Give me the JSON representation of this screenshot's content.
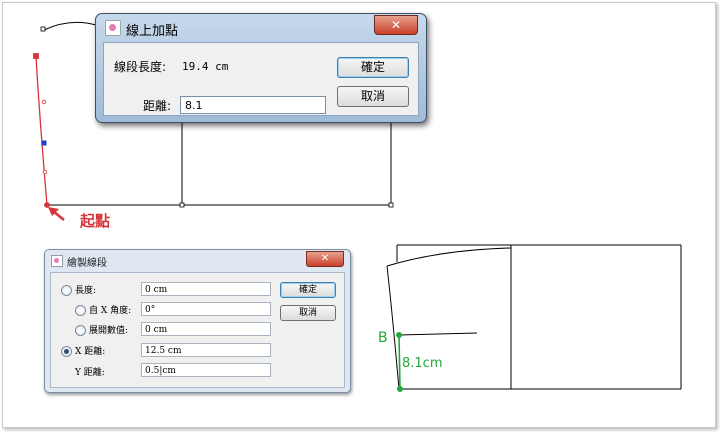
{
  "dialog_point": {
    "title": "線上加點",
    "close": "✕",
    "segment_length_label": "線段長度:",
    "segment_length_value": "19.4 cm",
    "distance_label": "距離:",
    "distance_value": "8.1",
    "ok": "確定",
    "cancel": "取消"
  },
  "dialog_segment": {
    "title": "繪製線段",
    "close": "✕",
    "length_label": "長度:",
    "length_value": "0 cm",
    "angle_label": "自 X 角度:",
    "angle_value": "0°",
    "offset_label": "展開數值:",
    "offset_value": "0 cm",
    "x_label": "X 距離:",
    "x_value": "12.5 cm",
    "y_label": "Y 距離:",
    "y_value": "0.5|cm",
    "ok": "確定",
    "cancel": "取消",
    "selected": "x"
  },
  "annotations": {
    "start_point": "起點",
    "point_b": "B",
    "green_length": "8.1cm"
  },
  "colors": {
    "red": "#d9343a",
    "green": "#22a83a"
  }
}
